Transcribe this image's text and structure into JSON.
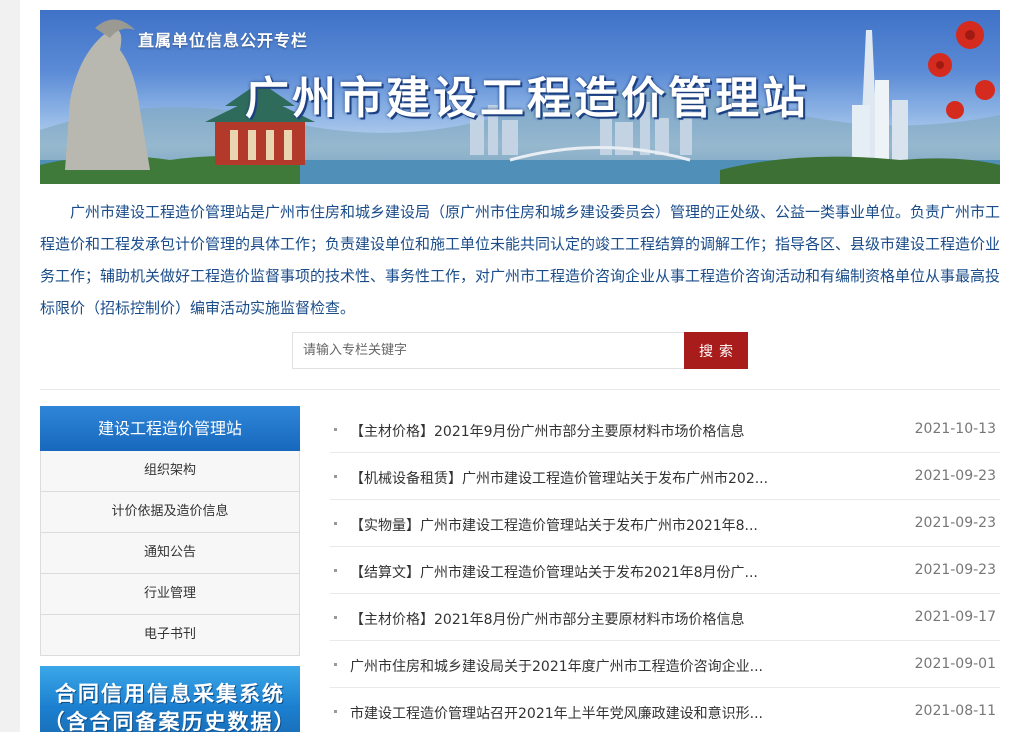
{
  "banner": {
    "subtitle": "直属单位信息公开专栏",
    "title": "广州市建设工程造价管理站"
  },
  "intro": "广州市建设工程造价管理站是广州市住房和城乡建设局（原广州市住房和城乡建设委员会）管理的正处级、公益一类事业单位。负责广州市工程造价和工程发承包计价管理的具体工作；负责建设单位和施工单位未能共同认定的竣工工程结算的调解工作；指导各区、县级市建设工程造价业务工作；辅助机关做好工程造价监督事项的技术性、事务性工作，对广州市工程造价咨询企业从事工程造价咨询活动和有编制资格单位从事最高投标限价（招标控制价）编审活动实施监督检查。",
  "search": {
    "placeholder": "请输入专栏关键字",
    "button": "搜索"
  },
  "sidebar": {
    "heading": "建设工程造价管理站",
    "items": [
      {
        "label": "组织架构"
      },
      {
        "label": "计价依据及造价信息"
      },
      {
        "label": "通知公告"
      },
      {
        "label": "行业管理"
      },
      {
        "label": "电子书刊"
      }
    ]
  },
  "promo": {
    "line1": "合同信用信息采集系统",
    "line2": "（含合同备案历史数据）"
  },
  "news": [
    {
      "title": "【主材价格】2021年9月份广州市部分主要原材料市场价格信息",
      "date": "2021-10-13"
    },
    {
      "title": "【机械设备租赁】广州市建设工程造价管理站关于发布广州市202...",
      "date": "2021-09-23"
    },
    {
      "title": "【实物量】广州市建设工程造价管理站关于发布广州市2021年8...",
      "date": "2021-09-23"
    },
    {
      "title": "【结算文】广州市建设工程造价管理站关于发布2021年8月份广...",
      "date": "2021-09-23"
    },
    {
      "title": "【主材价格】2021年8月份广州市部分主要原材料市场价格信息",
      "date": "2021-09-17"
    },
    {
      "title": "广州市住房和城乡建设局关于2021年度广州市工程造价咨询企业...",
      "date": "2021-09-01"
    },
    {
      "title": "市建设工程造价管理站召开2021年上半年党风廉政建设和意识形...",
      "date": "2021-08-11"
    }
  ]
}
